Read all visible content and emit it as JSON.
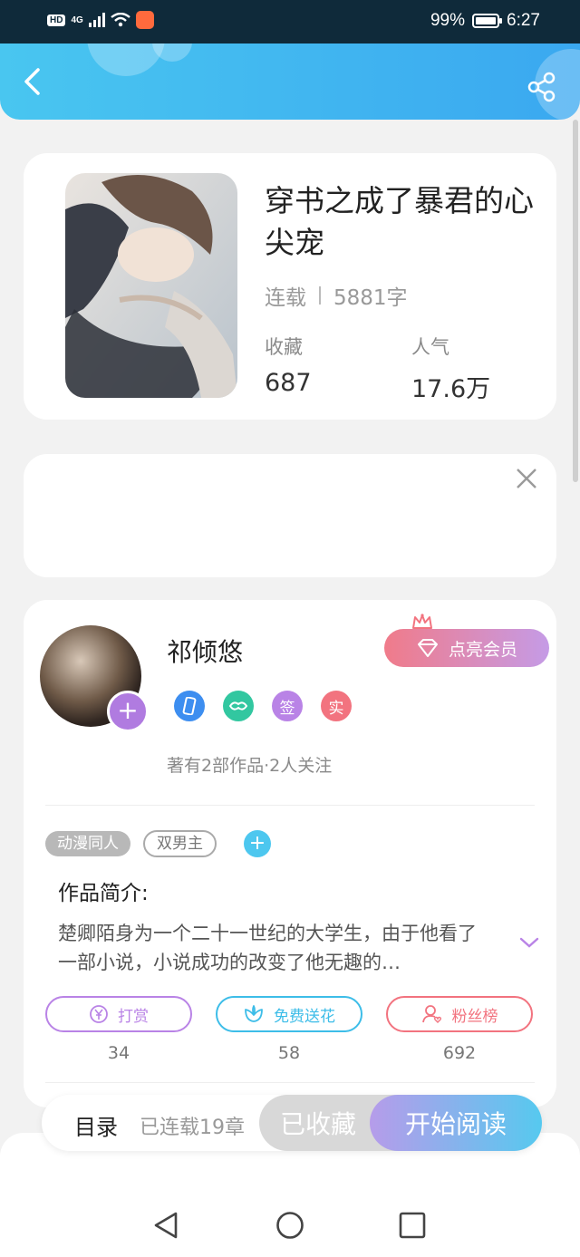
{
  "status_bar": {
    "network": "4G",
    "hd": "HD",
    "battery": "99%",
    "battery_level": 0.99,
    "time": "6:27"
  },
  "header": {
    "back_icon": "chevron-left-icon",
    "share_icon": "share-icon"
  },
  "book": {
    "title": "穿书之成了暴君的心尖宠",
    "status": "连载",
    "word_count": "5881字",
    "collect_label": "收藏",
    "collect_count": "687",
    "popularity_label": "人气",
    "popularity_count": "17.6万"
  },
  "ad": {
    "close_icon": "close-icon"
  },
  "author": {
    "name": "祁倾悠",
    "follow_icon": "plus-icon",
    "vip_label": "点亮会员",
    "badges": [
      {
        "icon": "phone-icon",
        "text": "",
        "color": "#3d8ef0"
      },
      {
        "icon": "handshake-icon",
        "text": "",
        "color": "#32c7a0"
      },
      {
        "icon": "",
        "text": "签",
        "color": "#b983e6"
      },
      {
        "icon": "",
        "text": "实",
        "color": "#f2737f"
      }
    ],
    "works_info": "著有2部作品·2人关注"
  },
  "tags": [
    "动漫同人",
    "双男主"
  ],
  "intro": {
    "title": "作品简介:",
    "text": "楚卿陌身为一个二十一世纪的大学生，由于他看了一部小说，小说成功的改变了他无趣的…"
  },
  "actions": [
    {
      "label": "打赏",
      "icon": "yen-icon",
      "count": "34",
      "color": "#b983e6"
    },
    {
      "label": "免费送花",
      "icon": "flower-icon",
      "count": "58",
      "color": "#3dbde8"
    },
    {
      "label": "粉丝榜",
      "icon": "fans-icon",
      "count": "692",
      "color": "#f2737f"
    }
  ],
  "bottom": {
    "toc_label": "目录",
    "chapters": "已连载19章",
    "favorited_label": "已收藏",
    "start_label": "开始阅读"
  },
  "colors": {
    "header_start": "#49c6f0",
    "header_end": "#3aa8f0",
    "accent_purple": "#b983e6",
    "accent_blue": "#56c9ef"
  }
}
